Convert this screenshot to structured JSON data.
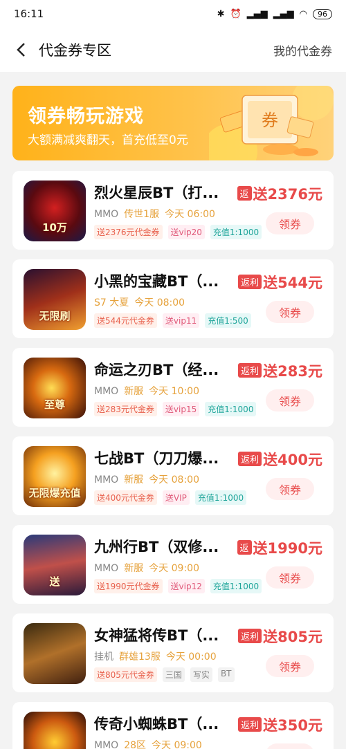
{
  "status": {
    "time": "16:11",
    "battery": "96"
  },
  "header": {
    "title": "代金券专区",
    "my_coupons": "我的代金券"
  },
  "banner": {
    "title": "领券畅玩游戏",
    "subtitle": "大额满减爽翻天，首充低至0元",
    "ticket_text": "券"
  },
  "colors": {
    "accent": "#e84a4a",
    "banner": "#ffb21a",
    "yellow_text": "#e6a23c"
  },
  "games": [
    {
      "name": "烈火星辰BT（打...",
      "t1": "MMO",
      "t2": "传世1服",
      "t3": "今天 06:00",
      "rebate": "返",
      "amount": "送2376元",
      "claim": "领券",
      "tags": [
        "送2376元代金券",
        "送vip20",
        "充值1:1000"
      ],
      "icon_text": "10万"
    },
    {
      "name": "小黑的宝藏BT（...",
      "t1": "",
      "t2": "S7 大夏",
      "t3": "今天 08:00",
      "rebate": "返利",
      "amount": "送544元",
      "claim": "领券",
      "tags": [
        "送544元代金券",
        "送vip11",
        "充值1:500"
      ],
      "icon_text": "无限刷"
    },
    {
      "name": "命运之刃BT（经...",
      "t1": "MMO",
      "t2": "新服",
      "t3": "今天 10:00",
      "rebate": "返利",
      "amount": "送283元",
      "claim": "领券",
      "tags": [
        "送283元代金券",
        "送vip15",
        "充值1:1000"
      ],
      "icon_text": "至尊"
    },
    {
      "name": "七战BT（刀刀爆...",
      "t1": "MMO",
      "t2": "新服",
      "t3": "今天 08:00",
      "rebate": "返利",
      "amount": "送400元",
      "claim": "领券",
      "tags": [
        "送400元代金券",
        "送VIP",
        "充值1:1000"
      ],
      "icon_text": "无限爆充值"
    },
    {
      "name": "九州行BT（双修...",
      "t1": "MMO",
      "t2": "新服",
      "t3": "今天 09:00",
      "rebate": "返",
      "amount": "送1990元",
      "claim": "领券",
      "tags": [
        "送1990元代金券",
        "送vip12",
        "充值1:1000"
      ],
      "icon_text": "送"
    },
    {
      "name": "女神猛将传BT（...",
      "t1": "挂机",
      "t2": "群雄13服",
      "t3": "今天 00:00",
      "rebate": "返利",
      "amount": "送805元",
      "claim": "领券",
      "tags": [
        "送805元代金券",
        "三国",
        "写实",
        "BT"
      ],
      "icon_text": ""
    },
    {
      "name": "传奇小蜘蛛BT（...",
      "t1": "MMO",
      "t2": "28区",
      "t3": "今天 09:00",
      "rebate": "返利",
      "amount": "送350元",
      "claim": "领券",
      "tags": [],
      "icon_text": ""
    }
  ]
}
